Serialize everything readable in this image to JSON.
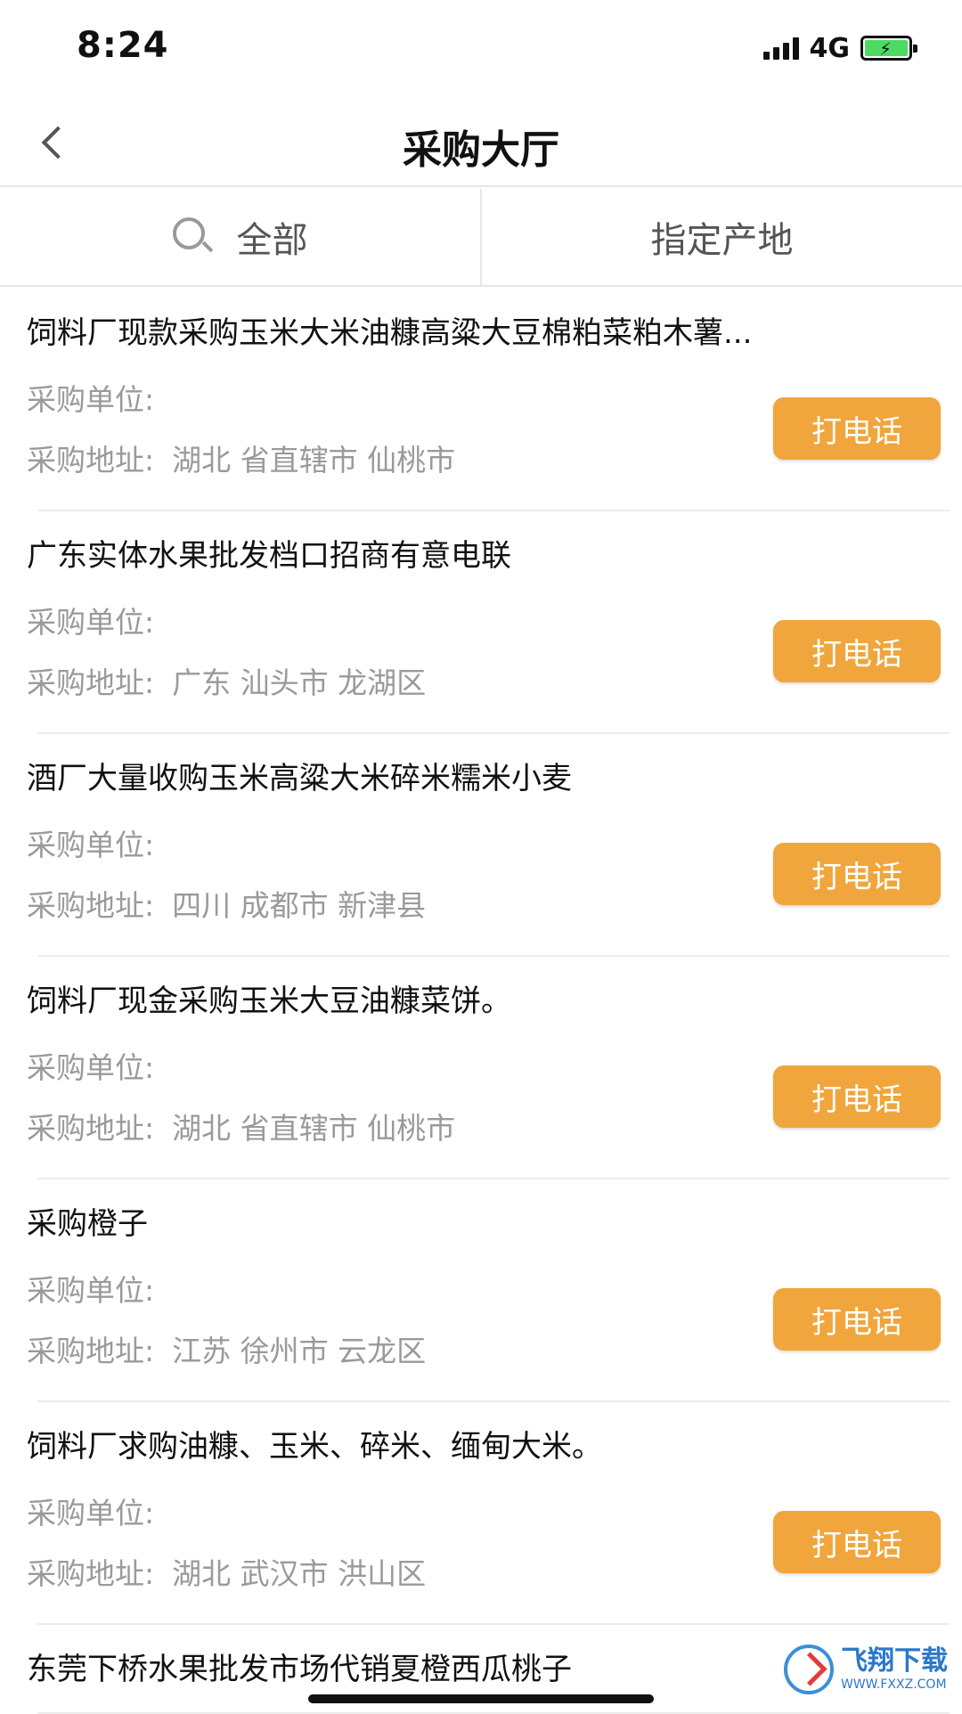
{
  "status_bar": {
    "time": "8:24",
    "network": "4G",
    "battery_icon": "battery-charging-icon",
    "signal_icon": "signal-bars-icon"
  },
  "nav": {
    "title": "采购大厅",
    "back_icon": "chevron-left-icon"
  },
  "filters": {
    "all_label": "全部",
    "origin_label": "指定产地",
    "search_icon": "search-icon"
  },
  "labels": {
    "unit": "采购单位:",
    "address": "采购地址:",
    "call": "打电话"
  },
  "items": [
    {
      "title": "饲料厂现款采购玉米大米油糠高粱大豆棉粕菜粕木薯...",
      "unit": "",
      "address": "湖北 省直辖市 仙桃市"
    },
    {
      "title": "广东实体水果批发档口招商有意电联",
      "unit": "",
      "address": "广东 汕头市 龙湖区"
    },
    {
      "title": "酒厂大量收购玉米高粱大米碎米糯米小麦",
      "unit": "",
      "address": "四川 成都市 新津县"
    },
    {
      "title": "饲料厂现金采购玉米大豆油糠菜饼。",
      "unit": "",
      "address": "湖北 省直辖市 仙桃市"
    },
    {
      "title": "采购橙子",
      "unit": "",
      "address": "江苏 徐州市 云龙区"
    },
    {
      "title": "饲料厂求购油糠、玉米、碎米、缅甸大米。",
      "unit": "",
      "address": "湖北 武汉市 洪山区"
    },
    {
      "title": "东莞下桥水果批发市场代销夏橙西瓜桃子",
      "unit": "",
      "address": ""
    }
  ],
  "watermark": {
    "main": "飞翔下载",
    "sub": "WWW.FXXZ.COM"
  },
  "colors": {
    "accent": "#f0a63c",
    "muted_text": "#9a9a9a",
    "divider": "#ececec"
  }
}
